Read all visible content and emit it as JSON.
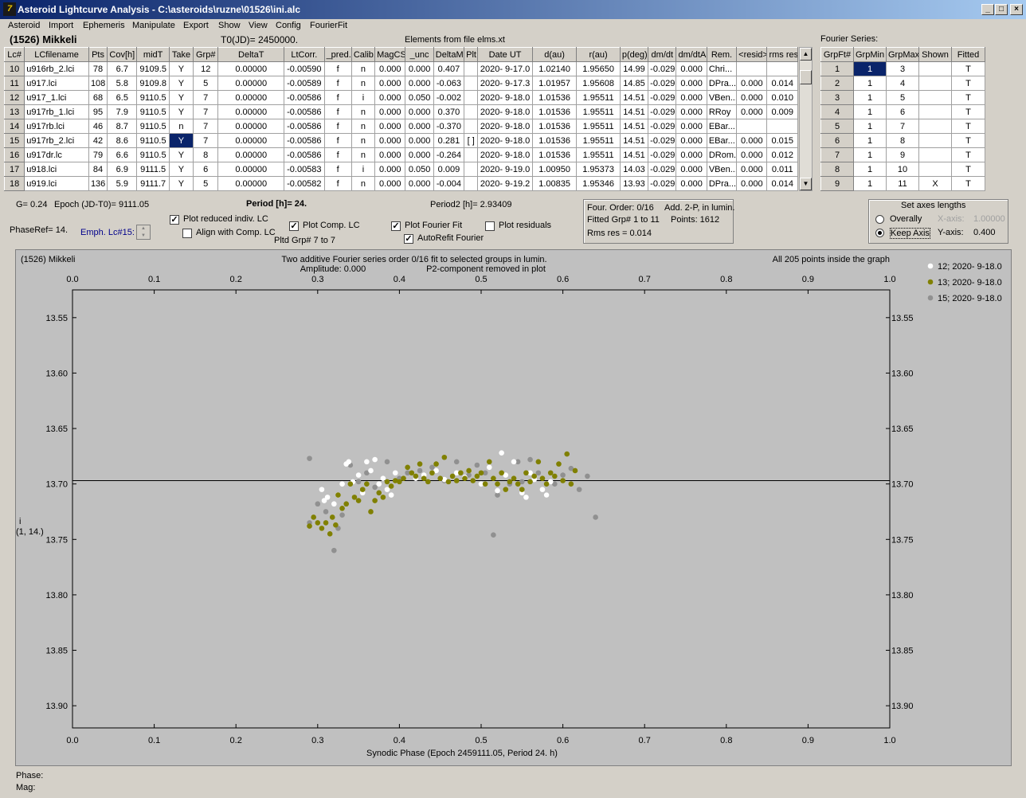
{
  "window": {
    "title": "Asteroid Lightcurve Analysis - C:\\asteroids\\ruzne\\01526\\ini.alc",
    "icon": "app-logo-icon",
    "min": "_",
    "max": "□",
    "close": "×"
  },
  "menu": [
    "Asteroid",
    "Import",
    "Ephemeris",
    "Manipulate",
    "Export",
    "Show",
    "View",
    "Config",
    "FourierFit"
  ],
  "header": {
    "asteroid": "(1526) Mikkeli",
    "t0": "T0(JD)= 2450000.",
    "elements": "Elements from file elms.xt",
    "fourier_label": "Fourier Series:"
  },
  "lc_table": {
    "columns": [
      "Lc#",
      "LCfilename",
      "Pts",
      "Cov[h]",
      "midT",
      "Take",
      "Grp#",
      "DeltaT",
      "LtCorr.",
      "_pred.",
      "Calib.",
      "MagCS",
      "_unc",
      "DeltaM",
      "Plt",
      "Date UT",
      "d(au)",
      "r(au)",
      "p(deg)",
      "dm/dt",
      "dm/dtA",
      "Rem.",
      "<resid>",
      "rms res"
    ],
    "rows": [
      [
        "10",
        "u916rb_2.lci",
        "78",
        "6.7",
        "9109.5",
        "Y",
        "12",
        "0.00000",
        "-0.00590",
        "f",
        "n",
        "0.000",
        "0.000",
        "0.407",
        "",
        "2020- 9-17.0",
        "1.02140",
        "1.95650",
        "14.99",
        "-0.029",
        "0.000",
        "Chri...",
        "",
        ""
      ],
      [
        "11",
        "u917.lci",
        "108",
        "5.8",
        "9109.8",
        "Y",
        "5",
        "0.00000",
        "-0.00589",
        "f",
        "n",
        "0.000",
        "0.000",
        "-0.063",
        "",
        "2020- 9-17.3",
        "1.01957",
        "1.95608",
        "14.85",
        "-0.029",
        "0.000",
        "DPra...",
        "0.000",
        "0.014"
      ],
      [
        "12",
        "u917_1.lci",
        "68",
        "6.5",
        "9110.5",
        "Y",
        "7",
        "0.00000",
        "-0.00586",
        "f",
        "i",
        "0.000",
        "0.050",
        "-0.002",
        "",
        "2020- 9-18.0",
        "1.01536",
        "1.95511",
        "14.51",
        "-0.029",
        "0.000",
        "VBen...",
        "0.000",
        "0.010"
      ],
      [
        "13",
        "u917rb_1.lci",
        "95",
        "7.9",
        "9110.5",
        "Y",
        "7",
        "0.00000",
        "-0.00586",
        "f",
        "n",
        "0.000",
        "0.000",
        "0.370",
        "",
        "2020- 9-18.0",
        "1.01536",
        "1.95511",
        "14.51",
        "-0.029",
        "0.000",
        "RRoy",
        "0.000",
        "0.009"
      ],
      [
        "14",
        "u917rb.lci",
        "46",
        "8.7",
        "9110.5",
        "n",
        "7",
        "0.00000",
        "-0.00586",
        "f",
        "n",
        "0.000",
        "0.000",
        "-0.370",
        "",
        "2020- 9-18.0",
        "1.01536",
        "1.95511",
        "14.51",
        "-0.029",
        "0.000",
        "EBar...",
        "",
        ""
      ],
      [
        "15",
        "u917rb_2.lci",
        "42",
        "8.6",
        "9110.5",
        "Y",
        "7",
        "0.00000",
        "-0.00586",
        "f",
        "n",
        "0.000",
        "0.000",
        "0.281",
        "[ ]",
        "2020- 9-18.0",
        "1.01536",
        "1.95511",
        "14.51",
        "-0.029",
        "0.000",
        "EBar...",
        "0.000",
        "0.015"
      ],
      [
        "16",
        "u917dr.lc",
        "79",
        "6.6",
        "9110.5",
        "Y",
        "8",
        "0.00000",
        "-0.00586",
        "f",
        "n",
        "0.000",
        "0.000",
        "-0.264",
        "",
        "2020- 9-18.0",
        "1.01536",
        "1.95511",
        "14.51",
        "-0.029",
        "0.000",
        "DRom...",
        "0.000",
        "0.012"
      ],
      [
        "17",
        "u918.lci",
        "84",
        "6.9",
        "9111.5",
        "Y",
        "6",
        "0.00000",
        "-0.00583",
        "f",
        "i",
        "0.000",
        "0.050",
        "0.009",
        "",
        "2020- 9-19.0",
        "1.00950",
        "1.95373",
        "14.03",
        "-0.029",
        "0.000",
        "VBen...",
        "0.000",
        "0.011"
      ],
      [
        "18",
        "u919.lci",
        "136",
        "5.9",
        "9111.7",
        "Y",
        "5",
        "0.00000",
        "-0.00582",
        "f",
        "n",
        "0.000",
        "0.000",
        "-0.004",
        "",
        "2020- 9-19.2",
        "1.00835",
        "1.95346",
        "13.93",
        "-0.029",
        "0.000",
        "DPra...",
        "0.000",
        "0.014"
      ]
    ]
  },
  "fourier_table": {
    "columns": [
      "GrpFt#",
      "GrpMin",
      "GrpMax",
      "Shown",
      "Fitted"
    ],
    "rows": [
      [
        "1",
        "1",
        "3",
        "",
        "T"
      ],
      [
        "2",
        "1",
        "4",
        "",
        "T"
      ],
      [
        "3",
        "1",
        "5",
        "",
        "T"
      ],
      [
        "4",
        "1",
        "6",
        "",
        "T"
      ],
      [
        "5",
        "1",
        "7",
        "",
        "T"
      ],
      [
        "6",
        "1",
        "8",
        "",
        "T"
      ],
      [
        "7",
        "1",
        "9",
        "",
        "T"
      ],
      [
        "8",
        "1",
        "10",
        "",
        "T"
      ],
      [
        "9",
        "1",
        "11",
        "X",
        "T"
      ]
    ]
  },
  "info": {
    "g": "G= 0.24",
    "epoch": "Epoch (JD-T0)= 9111.05",
    "period": "Period [h]= 24.",
    "period2": "Period2 [h]= 2.93409",
    "phaseref": "PhaseRef= 14.",
    "emph": "Emph. Lc#15:",
    "pltd_grp": "Pltd Grp#  7   to   7"
  },
  "checks": {
    "plot_reduced": {
      "label": "Plot reduced indiv. LC",
      "checked": "✓"
    },
    "align": {
      "label": "Align with Comp. LC",
      "checked": ""
    },
    "plot_comp": {
      "label": "Plot Comp. LC",
      "checked": "✓"
    },
    "plot_fourier": {
      "label": "Plot Fourier Fit",
      "checked": "✓"
    },
    "autorefit": {
      "label": "AutoRefit Fourier",
      "checked": "✓"
    },
    "plot_resid": {
      "label": "Plot residuals",
      "checked": ""
    }
  },
  "fit_box": {
    "l1a": "Four. Order:  0/16",
    "l1b": "Add. 2-P, in lumin.",
    "l2a": "Fitted Grp# 1 to 11",
    "l2b": "Points: 1612",
    "l3": "Rms res      = 0.014"
  },
  "axes_box": {
    "title": "Set axes lengths",
    "overally": "Overally",
    "keep": "Keep Axis",
    "xlabel": "X-axis:",
    "xval": "1.00000",
    "ylabel": "Y-axis:",
    "yval": "0.400"
  },
  "chart_data": {
    "type": "scatter",
    "title_left": "(1526) Mikkeli",
    "title_center": "Two additive Fourier series order 0/16 fit to selected groups in lumin.",
    "amplitude": "Amplitude: 0.000",
    "p2": "P2-component removed in plot",
    "title_right": "All 205 points inside the graph",
    "xlabel": "Synodic Phase (Epoch 2459111.05, Period 24. h)",
    "ylabel": "i",
    "ylabel2": "(1, 14.)",
    "xlim": [
      0,
      1
    ],
    "ylim": [
      13.92,
      13.525
    ],
    "xticks": [
      "0.0",
      "0.1",
      "0.2",
      "0.3",
      "0.4",
      "0.5",
      "0.6",
      "0.7",
      "0.8",
      "0.9",
      "1.0"
    ],
    "yticks": [
      "13.55",
      "13.60",
      "13.65",
      "13.70",
      "13.75",
      "13.80",
      "13.85",
      "13.90"
    ],
    "fit_line": 13.697,
    "series": [
      {
        "name": "12; 2020- 9-18.0",
        "color": "#ffffff",
        "points": [
          [
            0.305,
            13.705
          ],
          [
            0.308,
            13.715
          ],
          [
            0.312,
            13.712
          ],
          [
            0.32,
            13.718
          ],
          [
            0.325,
            13.71
          ],
          [
            0.33,
            13.7
          ],
          [
            0.335,
            13.682
          ],
          [
            0.338,
            13.68
          ],
          [
            0.343,
            13.698
          ],
          [
            0.35,
            13.692
          ],
          [
            0.355,
            13.708
          ],
          [
            0.36,
            13.68
          ],
          [
            0.365,
            13.688
          ],
          [
            0.37,
            13.678
          ],
          [
            0.375,
            13.7
          ],
          [
            0.38,
            13.695
          ],
          [
            0.385,
            13.705
          ],
          [
            0.39,
            13.71
          ],
          [
            0.395,
            13.69
          ],
          [
            0.42,
            13.695
          ],
          [
            0.43,
            13.692
          ],
          [
            0.445,
            13.688
          ],
          [
            0.455,
            13.696
          ],
          [
            0.47,
            13.69
          ],
          [
            0.48,
            13.694
          ],
          [
            0.5,
            13.7
          ],
          [
            0.51,
            13.685
          ],
          [
            0.52,
            13.706
          ],
          [
            0.525,
            13.672
          ],
          [
            0.53,
            13.692
          ],
          [
            0.54,
            13.68
          ],
          [
            0.55,
            13.708
          ],
          [
            0.555,
            13.712
          ],
          [
            0.56,
            13.69
          ],
          [
            0.565,
            13.696
          ],
          [
            0.575,
            13.705
          ],
          [
            0.58,
            13.71
          ],
          [
            0.585,
            13.698
          ]
        ]
      },
      {
        "name": "13; 2020- 9-18.0",
        "color": "#808000",
        "points": [
          [
            0.29,
            13.738
          ],
          [
            0.295,
            13.73
          ],
          [
            0.3,
            13.735
          ],
          [
            0.305,
            13.74
          ],
          [
            0.31,
            13.735
          ],
          [
            0.315,
            13.745
          ],
          [
            0.318,
            13.73
          ],
          [
            0.322,
            13.737
          ],
          [
            0.325,
            13.71
          ],
          [
            0.33,
            13.722
          ],
          [
            0.335,
            13.718
          ],
          [
            0.34,
            13.7
          ],
          [
            0.345,
            13.712
          ],
          [
            0.35,
            13.715
          ],
          [
            0.355,
            13.705
          ],
          [
            0.36,
            13.7
          ],
          [
            0.365,
            13.725
          ],
          [
            0.37,
            13.715
          ],
          [
            0.375,
            13.708
          ],
          [
            0.38,
            13.712
          ],
          [
            0.385,
            13.698
          ],
          [
            0.39,
            13.702
          ],
          [
            0.395,
            13.697
          ],
          [
            0.4,
            13.698
          ],
          [
            0.405,
            13.695
          ],
          [
            0.41,
            13.685
          ],
          [
            0.415,
            13.69
          ],
          [
            0.42,
            13.693
          ],
          [
            0.425,
            13.682
          ],
          [
            0.43,
            13.695
          ],
          [
            0.435,
            13.698
          ],
          [
            0.44,
            13.69
          ],
          [
            0.445,
            13.682
          ],
          [
            0.45,
            13.695
          ],
          [
            0.455,
            13.676
          ],
          [
            0.46,
            13.698
          ],
          [
            0.465,
            13.693
          ],
          [
            0.47,
            13.697
          ],
          [
            0.475,
            13.69
          ],
          [
            0.48,
            13.695
          ],
          [
            0.485,
            13.688
          ],
          [
            0.49,
            13.697
          ],
          [
            0.495,
            13.693
          ],
          [
            0.5,
            13.69
          ],
          [
            0.505,
            13.7
          ],
          [
            0.51,
            13.68
          ],
          [
            0.515,
            13.695
          ],
          [
            0.52,
            13.7
          ],
          [
            0.525,
            13.69
          ],
          [
            0.53,
            13.705
          ],
          [
            0.535,
            13.698
          ],
          [
            0.54,
            13.695
          ],
          [
            0.545,
            13.7
          ],
          [
            0.55,
            13.705
          ],
          [
            0.555,
            13.69
          ],
          [
            0.56,
            13.698
          ],
          [
            0.565,
            13.693
          ],
          [
            0.57,
            13.68
          ],
          [
            0.575,
            13.695
          ],
          [
            0.58,
            13.7
          ],
          [
            0.585,
            13.69
          ],
          [
            0.59,
            13.693
          ],
          [
            0.595,
            13.682
          ],
          [
            0.6,
            13.697
          ],
          [
            0.605,
            13.673
          ],
          [
            0.61,
            13.7
          ],
          [
            0.615,
            13.688
          ]
        ]
      },
      {
        "name": "15; 2020- 9-18.0",
        "color": "#909090",
        "points": [
          [
            0.29,
            13.677
          ],
          [
            0.29,
            13.735
          ],
          [
            0.3,
            13.718
          ],
          [
            0.31,
            13.725
          ],
          [
            0.32,
            13.76
          ],
          [
            0.325,
            13.74
          ],
          [
            0.33,
            13.728
          ],
          [
            0.34,
            13.683
          ],
          [
            0.35,
            13.698
          ],
          [
            0.36,
            13.69
          ],
          [
            0.37,
            13.703
          ],
          [
            0.385,
            13.68
          ],
          [
            0.4,
            13.695
          ],
          [
            0.41,
            13.69
          ],
          [
            0.425,
            13.688
          ],
          [
            0.44,
            13.685
          ],
          [
            0.455,
            13.697
          ],
          [
            0.47,
            13.68
          ],
          [
            0.485,
            13.692
          ],
          [
            0.495,
            13.683
          ],
          [
            0.505,
            13.69
          ],
          [
            0.515,
            13.746
          ],
          [
            0.52,
            13.71
          ],
          [
            0.535,
            13.7
          ],
          [
            0.545,
            13.68
          ],
          [
            0.55,
            13.698
          ],
          [
            0.56,
            13.678
          ],
          [
            0.57,
            13.69
          ],
          [
            0.58,
            13.71
          ],
          [
            0.59,
            13.7
          ],
          [
            0.6,
            13.692
          ],
          [
            0.61,
            13.686
          ],
          [
            0.62,
            13.705
          ],
          [
            0.63,
            13.693
          ],
          [
            0.64,
            13.73
          ]
        ]
      }
    ]
  },
  "status": {
    "phase": "Phase:",
    "mag": "Mag:"
  }
}
